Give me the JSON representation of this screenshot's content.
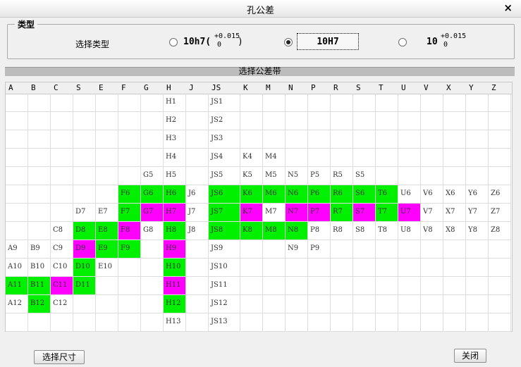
{
  "window": {
    "title": "孔公差",
    "close_glyph": "×"
  },
  "type_group": {
    "legend": "类型",
    "label": "选择类型",
    "options": [
      {
        "text": "10h7(",
        "tol_upper": "+0.015",
        "tol_lower": "0",
        "suffix": ")",
        "selected": false
      },
      {
        "text": "10H7",
        "selected": true
      },
      {
        "text": "10",
        "tol_upper": "+0.015",
        "tol_lower": "0",
        "selected": false
      }
    ]
  },
  "band_header": "选择公差带",
  "columns": [
    "A",
    "B",
    "C",
    "S",
    "E",
    "F",
    "G",
    "H",
    "J",
    "JS",
    "K",
    "M",
    "N",
    "P",
    "R",
    "S",
    "T",
    "U",
    "V",
    "X",
    "Y",
    "Z"
  ],
  "grid": [
    [
      "",
      "",
      "",
      "",
      "",
      "",
      "",
      "H1",
      "",
      "JS1",
      "",
      "",
      "",
      "",
      "",
      "",
      "",
      "",
      "",
      "",
      "",
      ""
    ],
    [
      "",
      "",
      "",
      "",
      "",
      "",
      "",
      "H2",
      "",
      "JS2",
      "",
      "",
      "",
      "",
      "",
      "",
      "",
      "",
      "",
      "",
      "",
      ""
    ],
    [
      "",
      "",
      "",
      "",
      "",
      "",
      "",
      "H3",
      "",
      "JS3",
      "",
      "",
      "",
      "",
      "",
      "",
      "",
      "",
      "",
      "",
      "",
      ""
    ],
    [
      "",
      "",
      "",
      "",
      "",
      "",
      "",
      "H4",
      "",
      "JS4",
      "K4",
      "M4",
      "",
      "",
      "",
      "",
      "",
      "",
      "",
      "",
      "",
      ""
    ],
    [
      "",
      "",
      "",
      "",
      "",
      "",
      "G5",
      "H5",
      "",
      "JS5",
      "K5",
      "M5",
      "N5",
      "P5",
      "R5",
      "S5",
      "",
      "",
      "",
      "",
      "",
      ""
    ],
    [
      "",
      "",
      "",
      "",
      "",
      "F6",
      "G6",
      "H6",
      "J6",
      "JS6",
      "K6",
      "M6",
      "N6",
      "P6",
      "R6",
      "S6",
      "T6",
      "U6",
      "V6",
      "X6",
      "Y6",
      "Z6"
    ],
    [
      "",
      "",
      "",
      "D7",
      "E7",
      "F7",
      "G7",
      "H7",
      "J7",
      "JS7",
      "K7",
      "M7",
      "N7",
      "P7",
      "R7",
      "S7",
      "T7",
      "U7",
      "V7",
      "X7",
      "Y7",
      "Z7"
    ],
    [
      "",
      "",
      "C8",
      "D8",
      "E8",
      "F8",
      "G8",
      "H8",
      "J8",
      "JS8",
      "K8",
      "M8",
      "N8",
      "P8",
      "R8",
      "S8",
      "T8",
      "U8",
      "V8",
      "X8",
      "Y8",
      "Z8"
    ],
    [
      "A9",
      "B9",
      "C9",
      "D9",
      "E9",
      "F9",
      "",
      "H9",
      "",
      "JS9",
      "",
      "",
      "N9",
      "P9",
      "",
      "",
      "",
      "",
      "",
      "",
      "",
      ""
    ],
    [
      "A10",
      "B10",
      "C10",
      "D10",
      "E10",
      "",
      "",
      "H10",
      "",
      "JS10",
      "",
      "",
      "",
      "",
      "",
      "",
      "",
      "",
      "",
      "",
      "",
      ""
    ],
    [
      "A11",
      "B11",
      "C11",
      "D11",
      "",
      "",
      "",
      "H11",
      "",
      "JS11",
      "",
      "",
      "",
      "",
      "",
      "",
      "",
      "",
      "",
      "",
      "",
      ""
    ],
    [
      "A12",
      "B12",
      "C12",
      "",
      "",
      "",
      "",
      "H12",
      "",
      "JS12",
      "",
      "",
      "",
      "",
      "",
      "",
      "",
      "",
      "",
      "",
      "",
      ""
    ],
    [
      "",
      "",
      "",
      "",
      "",
      "",
      "",
      "H13",
      "",
      "JS13",
      "",
      "",
      "",
      "",
      "",
      "",
      "",
      "",
      "",
      "",
      "",
      ""
    ]
  ],
  "highlight": {
    "green": [
      "F6",
      "G6",
      "H6",
      "JS6",
      "K6",
      "M6",
      "N6",
      "P6",
      "R6",
      "S6",
      "T6",
      "F7",
      "JS7",
      "R7",
      "T7",
      "D8",
      "E8",
      "H8",
      "JS8",
      "K8",
      "M8",
      "N8",
      "E9",
      "F9",
      "D10",
      "H10",
      "A11",
      "B11",
      "D11",
      "H12",
      "B12"
    ],
    "magenta": [
      "G7",
      "H7",
      "K7",
      "N7",
      "P7",
      "S7",
      "U7",
      "F8",
      "D9",
      "H9",
      "C11",
      "H11"
    ]
  },
  "colors": {
    "green": "#00f000",
    "magenta": "#ff00ff"
  },
  "buttons": {
    "select_size": "选择尺寸",
    "close": "关闭"
  }
}
